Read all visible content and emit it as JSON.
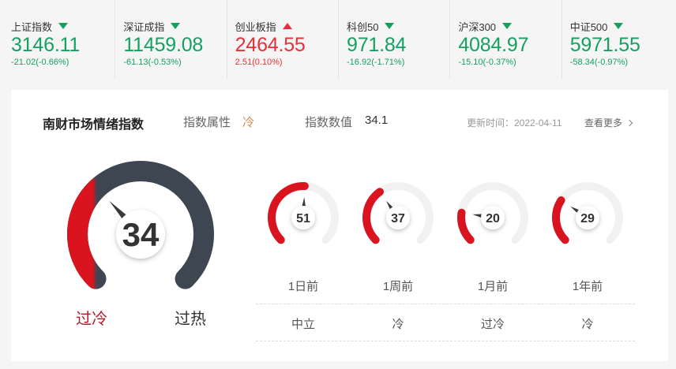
{
  "tickers": [
    {
      "name": "上证指数",
      "direction": "down",
      "value": "3146.11",
      "change": "-21.02(-0.66%)"
    },
    {
      "name": "深证成指",
      "direction": "down",
      "value": "11459.08",
      "change": "-61.13(-0.53%)"
    },
    {
      "name": "创业板指",
      "direction": "up",
      "value": "2464.55",
      "change": "2.51(0.10%)"
    },
    {
      "name": "科创50",
      "direction": "down",
      "value": "971.84",
      "change": "-16.92(-1.71%)"
    },
    {
      "name": "沪深300",
      "direction": "down",
      "value": "4084.97",
      "change": "-15.10(-0.37%)"
    },
    {
      "name": "中证500",
      "direction": "down",
      "value": "5971.55",
      "change": "-58.34(-0.97%)"
    }
  ],
  "sentiment": {
    "title": "南财市场情绪指数",
    "attr_label": "指数属性",
    "attr_value": "冷",
    "value_label": "指数数值",
    "value": "34.1",
    "update_time": "更新时间：2022-04-11",
    "more_label": "查看更多",
    "gauge": {
      "value": 34,
      "max": 100,
      "display": "34"
    },
    "cold_label": "过冷",
    "hot_label": "过热",
    "history": [
      {
        "period": "1日前",
        "value": 51,
        "display": "51",
        "state": "中立"
      },
      {
        "period": "1周前",
        "value": 37,
        "display": "37",
        "state": "冷"
      },
      {
        "period": "1月前",
        "value": 20,
        "display": "20",
        "state": "过冷"
      },
      {
        "period": "1年前",
        "value": 29,
        "display": "29",
        "state": "冷"
      }
    ]
  },
  "colors": {
    "down": "#16a060",
    "up": "#e8303a",
    "gauge_red": "#d9141f",
    "gauge_dark": "#3e4751",
    "gauge_track": "#f1f1f1"
  }
}
